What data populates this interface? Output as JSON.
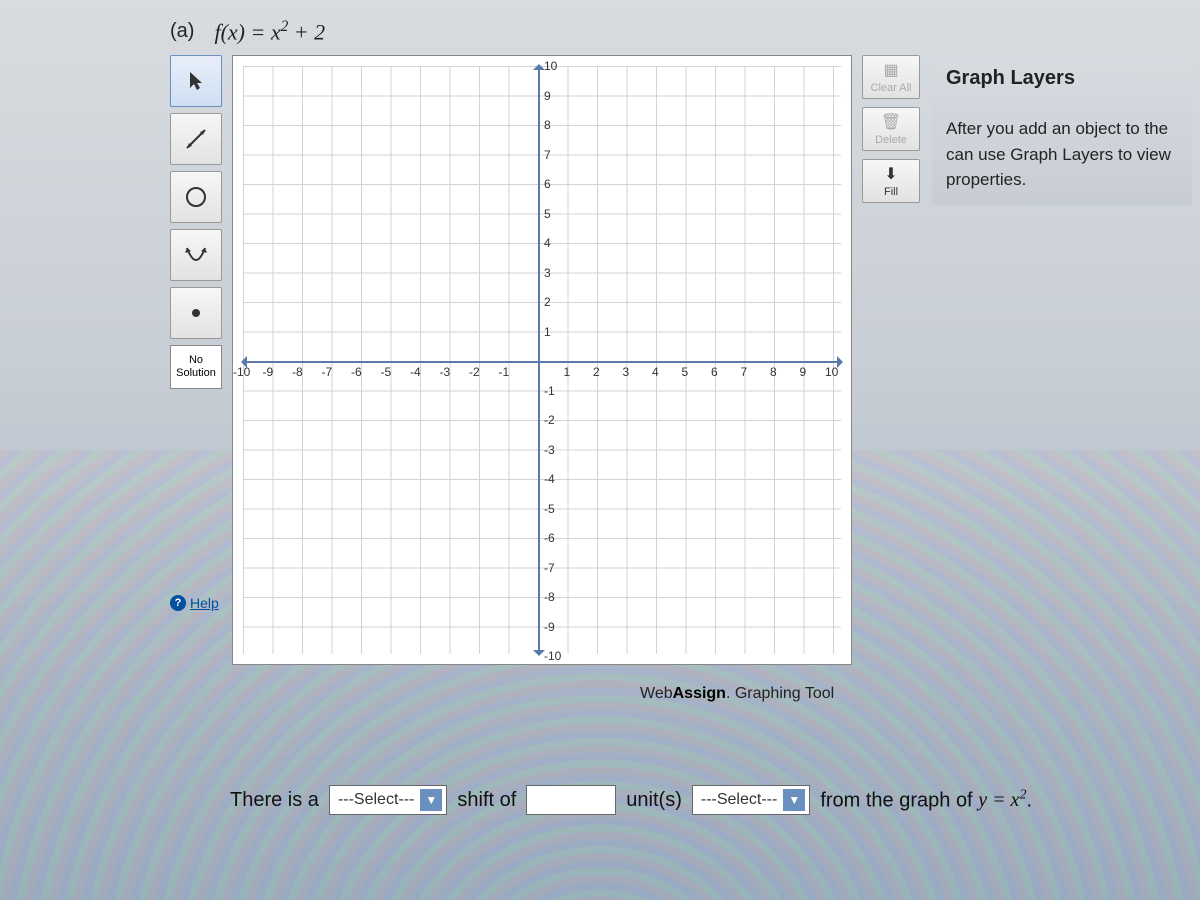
{
  "problem": {
    "part_label": "(a)",
    "function_html": "f(x) = x<span class='sup'>2</span> + 2"
  },
  "toolbar": {
    "pointer_name": "pointer",
    "line_name": "line-segment",
    "circle_name": "circle",
    "ray_name": "parabola",
    "point_name": "point",
    "no_solution_label": "No Solution",
    "help_label": "Help"
  },
  "side_buttons": {
    "clear_label": "Clear All",
    "delete_label": "Delete",
    "fill_label": "Fill"
  },
  "layers": {
    "title": "Graph Layers",
    "text": "After you add an object to the can use Graph Layers to view properties."
  },
  "chart_data": {
    "type": "scatter",
    "title": "",
    "xlabel": "",
    "ylabel": "",
    "xlim": [
      -10,
      10
    ],
    "ylim": [
      -10,
      10
    ],
    "x_ticks": [
      -10,
      -9,
      -8,
      -7,
      -6,
      -5,
      -4,
      -3,
      -2,
      -1,
      1,
      2,
      3,
      4,
      5,
      6,
      7,
      8,
      9,
      10
    ],
    "y_ticks": [
      10,
      9,
      8,
      7,
      6,
      5,
      4,
      3,
      2,
      1,
      -1,
      -2,
      -3,
      -4,
      -5,
      -6,
      -7,
      -8,
      -9,
      -10
    ],
    "series": []
  },
  "brand": {
    "prefix": "Web",
    "bold": "Assign",
    "suffix": ". Graphing Tool"
  },
  "answer": {
    "prefix": "There is a",
    "select1_placeholder": "---Select---",
    "mid1": "shift of",
    "units_label": "unit(s)",
    "select2_placeholder": "---Select---",
    "suffix_html": "from the graph of  <span class='eq'>y = x<span class=\"sup\">2</span></span>."
  }
}
